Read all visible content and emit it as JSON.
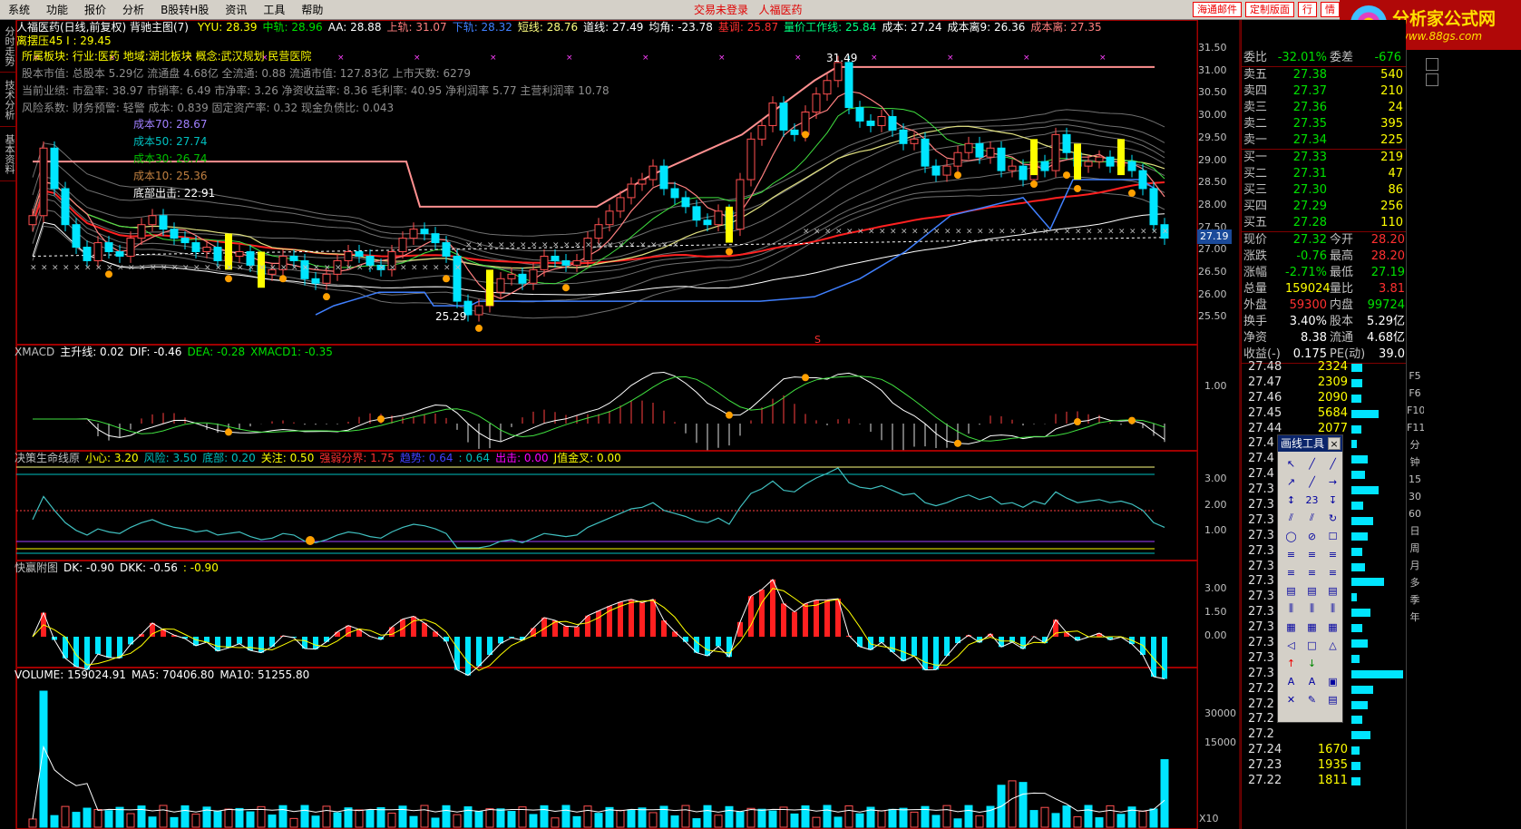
{
  "menubar": {
    "items": [
      "系统",
      "功能",
      "报价",
      "分析",
      "B股转H股",
      "资讯",
      "工具",
      "帮助"
    ],
    "center_text": [
      "交易未登录",
      "人福医药"
    ],
    "buttons": [
      "海通邮件",
      "定制版面",
      "行",
      "情"
    ]
  },
  "logo": {
    "title": "分析家公式网",
    "url": "www.88gs.com"
  },
  "left_tabs": [
    "分时走势",
    "技术分析",
    "基本资料"
  ],
  "main_panel": {
    "title": "人福医药(日线,前复权) 背驰主图(7)",
    "indicators": [
      {
        "text": "YYU: 28.39",
        "color": "#ffff00"
      },
      {
        "text": "中轨: 28.96",
        "color": "#00e000"
      },
      {
        "text": "AA: 28.88",
        "color": "#ffffff"
      },
      {
        "text": "上轨: 31.07",
        "color": "#ff8080"
      },
      {
        "text": "下轨: 28.32",
        "color": "#4080ff"
      },
      {
        "text": "短线: 28.76",
        "color": "#ffff80"
      },
      {
        "text": "道线: 27.49",
        "color": "#ffffff"
      },
      {
        "text": "均角: -23.78",
        "color": "#ffffff"
      },
      {
        "text": "基调: 25.87",
        "color": "#ff3030"
      },
      {
        "text": "量价工作线: 25.84",
        "color": "#00ff80"
      },
      {
        "text": "成本: 27.24",
        "color": "#ffffff"
      },
      {
        "text": "成本离9: 26.36",
        "color": "#ffffff"
      },
      {
        "text": "成本离: 27.35",
        "color": "#ff8080"
      }
    ],
    "second_line": "离摆压45 I : 29.45",
    "info_lines": [
      {
        "text": "所属板块: 行业:医药 地域:湖北板块 概念:武汉规划 民营医院",
        "color": "#ffff00"
      },
      {
        "text": "股本市值: 总股本 5.29亿 流通盘 4.68亿 全流通: 0.88 流通市值: 127.83亿 上市天数: 6279",
        "color": "#909090"
      },
      {
        "text": "当前业绩: 市盈率: 38.97 市销率: 6.49 市净率: 3.26 净资收益率: 8.36 毛利率: 40.95 净利润率 5.77 主营利润率 10.78",
        "color": "#909090"
      },
      {
        "text": "风险系数: 财务预警: 轻警 成本: 0.839 固定资产率: 0.32 现金负债比: 0.043",
        "color": "#909090"
      }
    ],
    "cost_labels": [
      {
        "text": "成本70: 28.67",
        "color": "#a080ff"
      },
      {
        "text": "成本50: 27.74",
        "color": "#00c0c0"
      },
      {
        "text": "成本30: 26.74",
        "color": "#00c000"
      },
      {
        "text": "成本10: 25.36",
        "color": "#c08040"
      },
      {
        "text": "底部出击: 22.91",
        "color": "#ffffff"
      }
    ],
    "annotations": {
      "high": "31.49",
      "low": "25.29",
      "s_mark": "S"
    },
    "y_axis": [
      "31.50",
      "31.00",
      "30.50",
      "30.00",
      "29.50",
      "29.00",
      "28.50",
      "28.00",
      "27.50",
      "27.00",
      "26.50",
      "26.00",
      "25.50"
    ],
    "current_price_tag": "27.19"
  },
  "xmacd_panel": {
    "labels": [
      {
        "text": "XMACD",
        "color": "#c0c0c0"
      },
      {
        "text": "主升线: 0.02",
        "color": "#ffffff"
      },
      {
        "text": "DIF: -0.46",
        "color": "#ffffff"
      },
      {
        "text": "DEA: -0.28",
        "color": "#00e000"
      },
      {
        "text": "XMACD1: -0.35",
        "color": "#00e000"
      }
    ],
    "y_axis": [
      "1.00"
    ]
  },
  "lifeline_panel": {
    "labels": [
      {
        "text": "决策生命线原",
        "color": "#c0c0c0"
      },
      {
        "text": "小心: 3.20",
        "color": "#ffff00"
      },
      {
        "text": "风险: 3.50",
        "color": "#00c0c0"
      },
      {
        "text": "底部: 0.20",
        "color": "#00c0c0"
      },
      {
        "text": "关注: 0.50",
        "color": "#ffff00"
      },
      {
        "text": "强弱分界: 1.75",
        "color": "#ff3030"
      },
      {
        "text": "趋势: 0.64",
        "color": "#4040ff"
      },
      {
        "text": ": 0.64",
        "color": "#00c0c0"
      },
      {
        "text": "出击: 0.00",
        "color": "#ff00ff"
      },
      {
        "text": "J值金叉: 0.00",
        "color": "#ffff00"
      }
    ],
    "y_axis": [
      "3.00",
      "2.00",
      "1.00"
    ]
  },
  "kuaiying_panel": {
    "labels": [
      {
        "text": "快赢附图",
        "color": "#c0c0c0"
      },
      {
        "text": "DK: -0.90",
        "color": "#ffffff"
      },
      {
        "text": "DKK: -0.56",
        "color": "#ffffff"
      },
      {
        "text": ": -0.90",
        "color": "#ffff00"
      }
    ],
    "y_axis": [
      "3.00",
      "1.50",
      "0.00"
    ]
  },
  "volume_panel": {
    "labels": [
      {
        "text": "VOLUME: 159024.91",
        "color": "#ffffff"
      },
      {
        "text": "MA5: 70406.80",
        "color": "#ffffff"
      },
      {
        "text": "MA10: 51255.80",
        "color": "#ffffff"
      }
    ],
    "y_axis": [
      "30000",
      "15000"
    ],
    "unit": "X10"
  },
  "quote": {
    "ratio": {
      "label": "委比",
      "value": "-32.01%",
      "label2": "委差",
      "value2": "-676"
    },
    "asks": [
      {
        "label": "卖五",
        "price": "27.38",
        "vol": "540"
      },
      {
        "label": "卖四",
        "price": "27.37",
        "vol": "210"
      },
      {
        "label": "卖三",
        "price": "27.36",
        "vol": "24"
      },
      {
        "label": "卖二",
        "price": "27.35",
        "vol": "395"
      },
      {
        "label": "卖一",
        "price": "27.34",
        "vol": "225"
      }
    ],
    "bids": [
      {
        "label": "买一",
        "price": "27.33",
        "vol": "219"
      },
      {
        "label": "买二",
        "price": "27.31",
        "vol": "47"
      },
      {
        "label": "买三",
        "price": "27.30",
        "vol": "86"
      },
      {
        "label": "买四",
        "price": "27.29",
        "vol": "256"
      },
      {
        "label": "买五",
        "price": "27.28",
        "vol": "110"
      }
    ],
    "stats": [
      {
        "l1": "现价",
        "v1": "27.32",
        "c1": "#00e000",
        "l2": "今开",
        "v2": "28.20",
        "c2": "#ff3030"
      },
      {
        "l1": "涨跌",
        "v1": "-0.76",
        "c1": "#00e000",
        "l2": "最高",
        "v2": "28.20",
        "c2": "#ff3030"
      },
      {
        "l1": "涨幅",
        "v1": "-2.71%",
        "c1": "#00e000",
        "l2": "最低",
        "v2": "27.19",
        "c2": "#00e000"
      },
      {
        "l1": "总量",
        "v1": "159024",
        "c1": "#ffff00",
        "l2": "量比",
        "v2": "3.81",
        "c2": "#ff3030"
      },
      {
        "l1": "外盘",
        "v1": "59300",
        "c1": "#ff3030",
        "l2": "内盘",
        "v2": "99724",
        "c2": "#00e000"
      },
      {
        "l1": "换手",
        "v1": "3.40%",
        "c1": "#ffffff",
        "l2": "股本",
        "v2": "5.29亿",
        "c2": "#ffffff"
      },
      {
        "l1": "净资",
        "v1": "8.38",
        "c1": "#ffffff",
        "l2": "流通",
        "v2": "4.68亿",
        "c2": "#ffffff"
      },
      {
        "l1": "收益(-)",
        "v1": "0.175",
        "c1": "#ffffff",
        "l2": "PE(动)",
        "v2": "39.0",
        "c2": "#ffffff"
      }
    ]
  },
  "depth": [
    {
      "price": "27.48",
      "qty": "2324",
      "bar": 0.2
    },
    {
      "price": "27.47",
      "qty": "2309",
      "bar": 0.2
    },
    {
      "price": "27.46",
      "qty": "2090",
      "bar": 0.18
    },
    {
      "price": "27.45",
      "qty": "5684",
      "bar": 0.5
    },
    {
      "price": "27.44",
      "qty": "2077",
      "bar": 0.18
    },
    {
      "price": "27.4",
      "qty": "",
      "bar": 0.1
    },
    {
      "price": "27.4",
      "qty": "",
      "bar": 0.3
    },
    {
      "price": "27.4",
      "qty": "",
      "bar": 0.25
    },
    {
      "price": "27.3",
      "qty": "",
      "bar": 0.5
    },
    {
      "price": "27.3",
      "qty": "",
      "bar": 0.22
    },
    {
      "price": "27.3",
      "qty": "",
      "bar": 0.4
    },
    {
      "price": "27.3",
      "qty": "",
      "bar": 0.3
    },
    {
      "price": "27.3",
      "qty": "",
      "bar": 0.2
    },
    {
      "price": "27.3",
      "qty": "",
      "bar": 0.25
    },
    {
      "price": "27.3",
      "qty": "",
      "bar": 0.6
    },
    {
      "price": "27.3",
      "qty": "",
      "bar": 0.1
    },
    {
      "price": "27.3",
      "qty": "",
      "bar": 0.35
    },
    {
      "price": "27.3",
      "qty": "",
      "bar": 0.2
    },
    {
      "price": "27.3",
      "qty": "",
      "bar": 0.3
    },
    {
      "price": "27.3",
      "qty": "",
      "bar": 0.15
    },
    {
      "price": "27.3",
      "qty": "",
      "bar": 0.95
    },
    {
      "price": "27.2",
      "qty": "",
      "bar": 0.4
    },
    {
      "price": "27.2",
      "qty": "",
      "bar": 0.3
    },
    {
      "price": "27.2",
      "qty": "",
      "bar": 0.2
    },
    {
      "price": "27.2",
      "qty": "",
      "bar": 0.35
    },
    {
      "price": "27.24",
      "qty": "1670",
      "bar": 0.15
    },
    {
      "price": "27.23",
      "qty": "1935",
      "bar": 0.17
    },
    {
      "price": "27.22",
      "qty": "1811",
      "bar": 0.16
    }
  ],
  "right_tabs": [
    "F5",
    "F6",
    "F10",
    "F11",
    "分",
    "钟",
    "15",
    "30",
    "60",
    "日",
    "周",
    "月",
    "多",
    "季",
    "年"
  ],
  "toolbox": {
    "title": "画线工具",
    "close": "×"
  }
}
